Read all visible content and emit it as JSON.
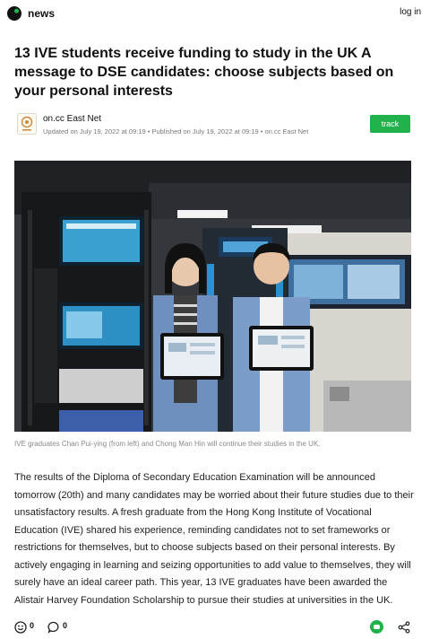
{
  "header": {
    "brand": "news",
    "login": "log in",
    "logo_icon": "oncc-logo-icon"
  },
  "article": {
    "title": "13 IVE students receive funding to study in the UK A message to DSE candidates: choose subjects based on your personal interests",
    "author": "on.cc East Net",
    "meta": "Updated on July 19, 2022 at 09:19 • Published on July 19, 2022 at 09:19 • on.cc East Net",
    "track_label": "track",
    "image_caption": "IVE graduates Chan Pui-ying (from left) and Chong Man Hin will continue their studies in the UK.",
    "body": "The results of the Diploma of Secondary Education Examination will be announced tomorrow (20th) and many candidates may be worried about their future studies due to their unsatisfactory results. A fresh graduate from the Hong Kong Institute of Vocational Education (IVE) shared his experience, reminding candidates not to set frameworks or restrictions for themselves, but to choose subjects based on their personal interests. By actively engaging in learning and seizing opportunities to add value to themselves, they will surely have an ideal career path. This year, 13 IVE graduates have been awarded the Alistair Harvey Foundation Scholarship to pursue their studies at universities in the UK."
  },
  "footer": {
    "reactions_count": "0",
    "comments_count": "0"
  },
  "colors": {
    "accent": "#22b24c",
    "text": "#1a1a1a",
    "muted": "#7a7a7a"
  }
}
